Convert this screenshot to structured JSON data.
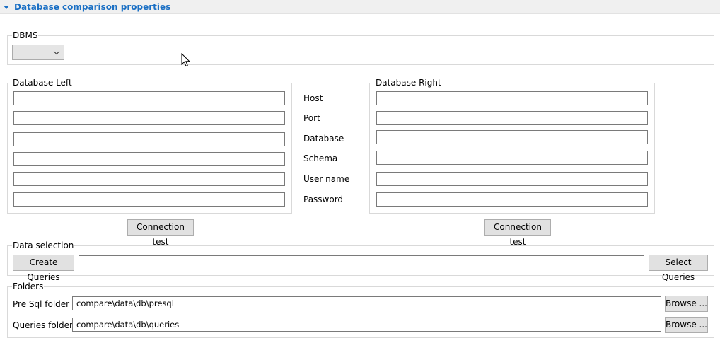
{
  "header": {
    "title": "Database comparison properties",
    "icon": "triangle-down-icon"
  },
  "dbms": {
    "legend": "DBMS",
    "value": ""
  },
  "left": {
    "legend": "Database Left",
    "host": "",
    "port": "",
    "database": "",
    "schema": "",
    "user": "",
    "password": "",
    "test_label": "Connection test"
  },
  "right": {
    "legend": "Database Right",
    "host": "",
    "port": "",
    "database": "",
    "schema": "",
    "user": "",
    "password": "",
    "test_label": "Connection test"
  },
  "labels": {
    "host": "Host",
    "port": "Port",
    "database": "Database",
    "schema": "Schema",
    "user": "User name",
    "password": "Password"
  },
  "data_selection": {
    "legend": "Data selection",
    "create_label": "Create Queries",
    "query_value": "",
    "select_label": "Select Queries"
  },
  "folders": {
    "legend": "Folders",
    "presql_label": "Pre Sql folder :",
    "presql_value": "compare\\data\\db\\presql",
    "queries_label": "Queries folder :",
    "queries_value": "compare\\data\\db\\queries",
    "browse_label": "Browse ..."
  },
  "colors": {
    "accent": "#1a6fc4",
    "header_bg": "#f0f0f0"
  }
}
